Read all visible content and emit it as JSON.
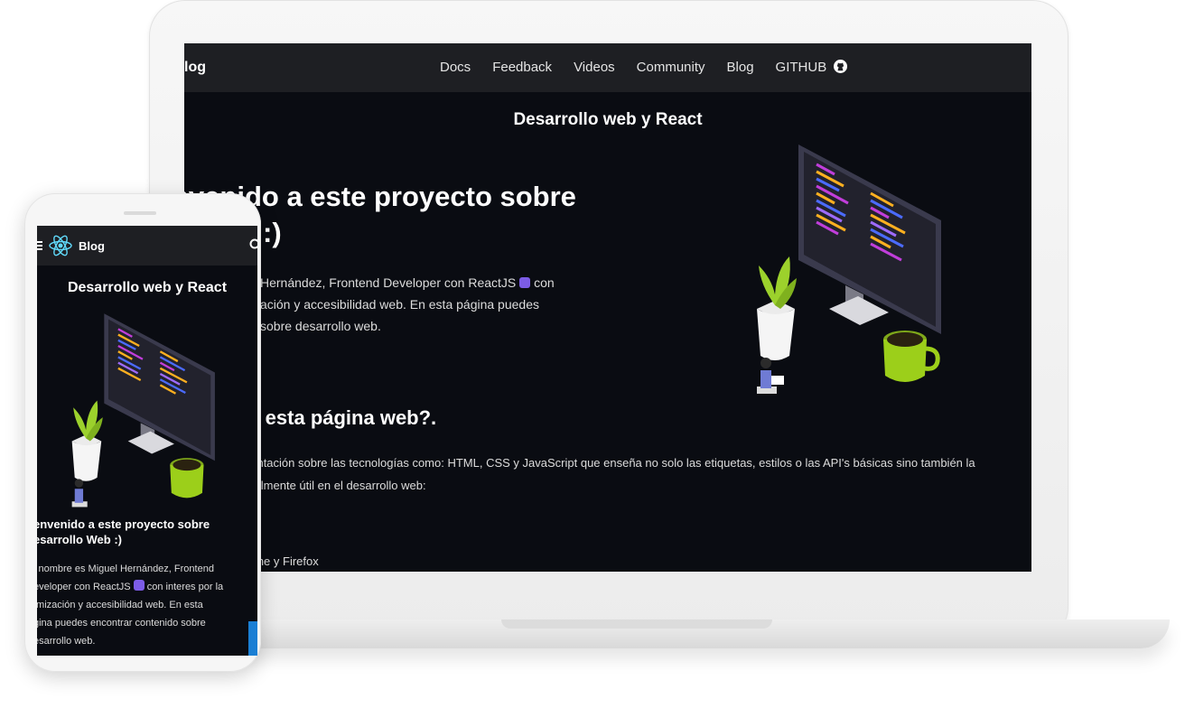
{
  "desktop": {
    "brand": "log",
    "nav": [
      "Docs",
      "Feedback",
      "Videos",
      "Community",
      "Blog",
      "GITHUB"
    ],
    "subtitle": "Desarrollo web y React",
    "hero_line1": "nvenido a este proyecto sobre",
    "hero_line2": "o Web :)",
    "intro_line1": "Hernández, Frontend Developer con ReactJS",
    "intro_line1_end": "con",
    "intro_line2": "ación y accesibilidad web. En esta página puedes",
    "intro_line3": "sobre desarrollo web.",
    "section_heading": "ta esta página web?.",
    "section_line1": "nentación sobre las tecnologías como: HTML, CSS y JavaScript que enseña no solo las etiquetas, estilos o las API's básicas sino también la",
    "section_line2": "realmente útil en el desarrollo web:",
    "list_dot": "o",
    "list_item": "ome y Firefox"
  },
  "mobile": {
    "brand": "Blog",
    "title": "Desarrollo web y React",
    "hero_line1": "envenido a este proyecto sobre",
    "hero_line2": "esarrollo Web :)",
    "p_line1": "i nombre es Miguel Hernández, Frontend",
    "p_line2": "eveloper con ReactJS",
    "p_line2_end": "con interes por la",
    "p_line3": "tmización y accesibilidad web. En esta",
    "p_line4": "gina puedes encontrar contenido sobre",
    "p_line5": "esarrollo web."
  },
  "icons": {
    "github": "github-icon",
    "react_logo": "react-logo-icon",
    "react_emoji": "react-emoji-icon",
    "menu": "menu-icon",
    "search": "search-icon"
  },
  "colors": {
    "screen_bg": "#0a0c12",
    "nav_bg": "#1e1f23",
    "react_blue": "#61dafb",
    "accent_purple": "#7c5ce6",
    "plant_green": "#9cd12c",
    "mug_green": "#9ccf1a"
  }
}
